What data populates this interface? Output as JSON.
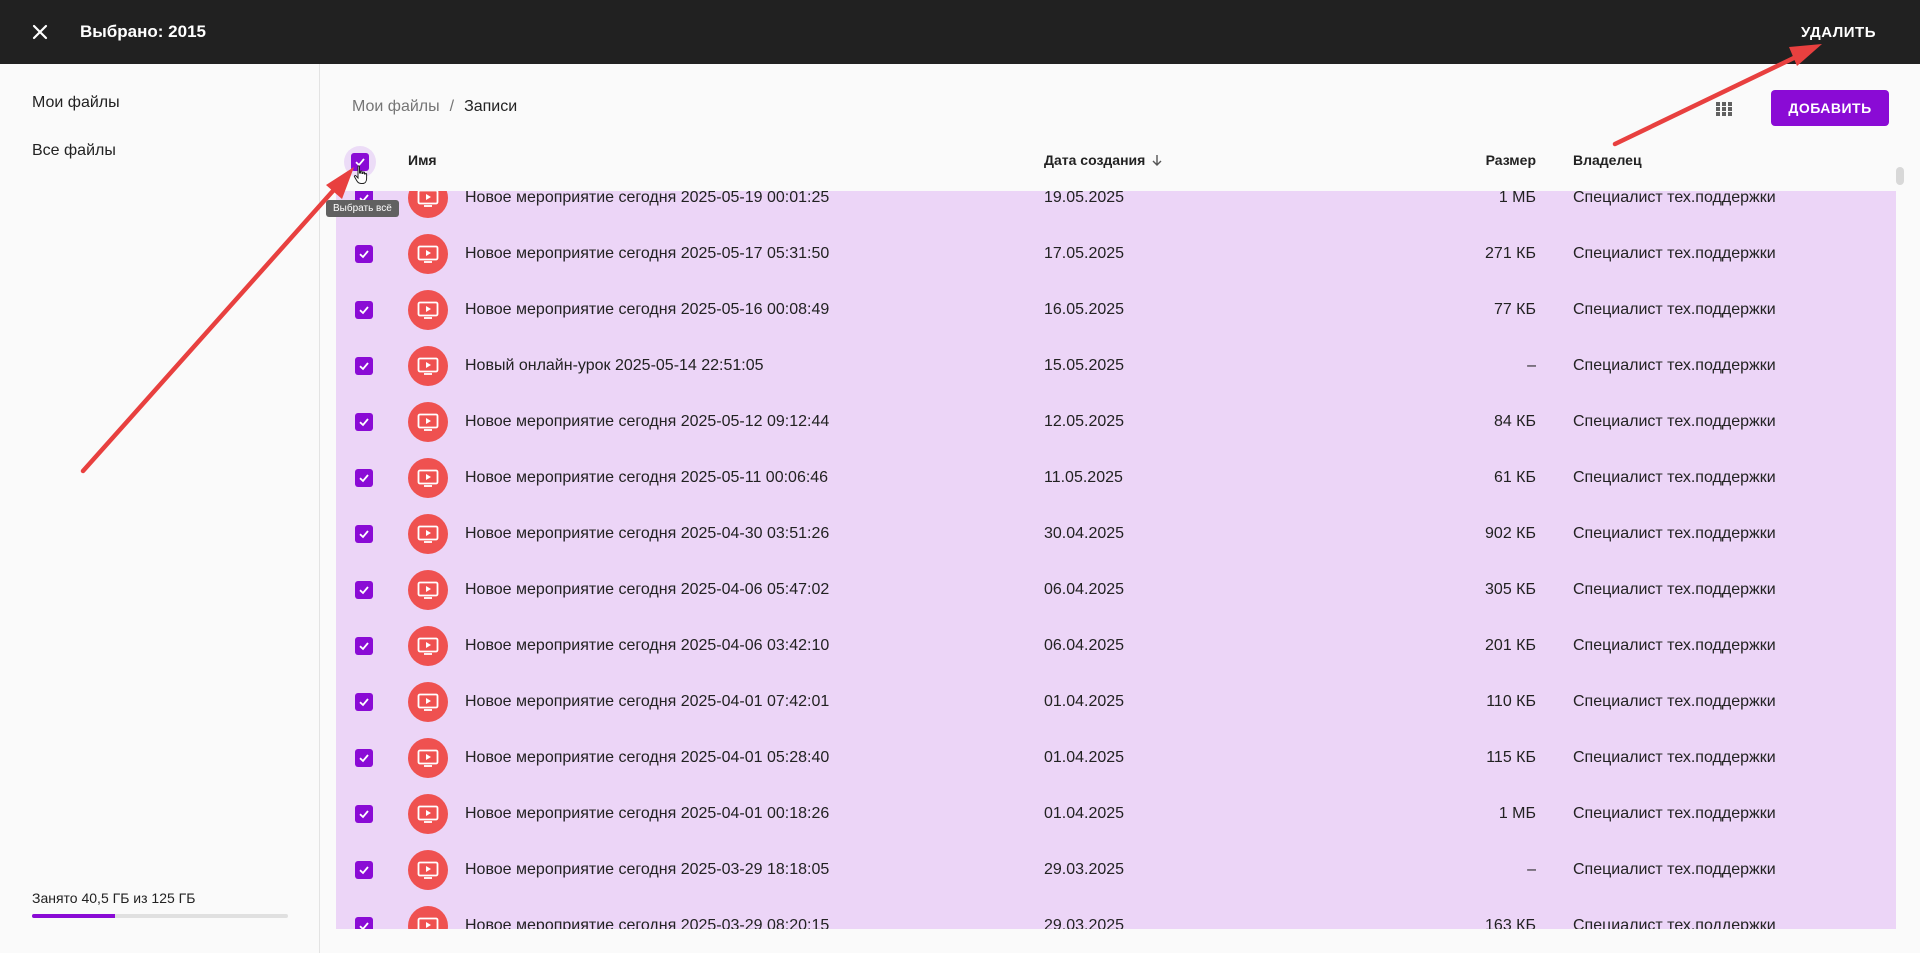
{
  "topbar": {
    "close_icon": "close-icon",
    "selected_label": "Выбрано: 2015",
    "delete_label": "УДАЛИТЬ"
  },
  "sidebar": {
    "items": [
      {
        "label": "Мои файлы"
      },
      {
        "label": "Все файлы"
      }
    ],
    "storage": {
      "label": "Занято 40,5 ГБ из 125 ГБ",
      "used_fraction": 0.324
    }
  },
  "breadcrumb": {
    "parent": "Мои файлы",
    "separator": "/",
    "current": "Записи"
  },
  "toolbar": {
    "grid_icon": "grid-view-icon",
    "add_label": "ДОБАВИТЬ"
  },
  "table": {
    "columns": {
      "name": "Имя",
      "date": "Дата создания",
      "size": "Размер",
      "owner": "Владелец"
    },
    "sort_icon": "arrow-down-icon",
    "select_all_tooltip": "Выбрать всё",
    "rows": [
      {
        "name": "Новое мероприятие сегодня 2025-05-19 00:01:25",
        "date": "19.05.2025",
        "size": "1 МБ",
        "owner": "Специалист тех.поддержки"
      },
      {
        "name": "Новое мероприятие сегодня 2025-05-17 05:31:50",
        "date": "17.05.2025",
        "size": "271 КБ",
        "owner": "Специалист тех.поддержки"
      },
      {
        "name": "Новое мероприятие сегодня 2025-05-16 00:08:49",
        "date": "16.05.2025",
        "size": "77 КБ",
        "owner": "Специалист тех.поддержки"
      },
      {
        "name": "Новый онлайн-урок 2025-05-14 22:51:05",
        "date": "15.05.2025",
        "size": "–",
        "owner": "Специалист тех.поддержки"
      },
      {
        "name": "Новое мероприятие сегодня 2025-05-12 09:12:44",
        "date": "12.05.2025",
        "size": "84 КБ",
        "owner": "Специалист тех.поддержки"
      },
      {
        "name": "Новое мероприятие сегодня 2025-05-11 00:06:46",
        "date": "11.05.2025",
        "size": "61 КБ",
        "owner": "Специалист тех.поддержки"
      },
      {
        "name": "Новое мероприятие сегодня 2025-04-30 03:51:26",
        "date": "30.04.2025",
        "size": "902 КБ",
        "owner": "Специалист тех.поддержки"
      },
      {
        "name": "Новое мероприятие сегодня 2025-04-06 05:47:02",
        "date": "06.04.2025",
        "size": "305 КБ",
        "owner": "Специалист тех.поддержки"
      },
      {
        "name": "Новое мероприятие сегодня 2025-04-06 03:42:10",
        "date": "06.04.2025",
        "size": "201 КБ",
        "owner": "Специалист тех.поддержки"
      },
      {
        "name": "Новое мероприятие сегодня 2025-04-01 07:42:01",
        "date": "01.04.2025",
        "size": "110 КБ",
        "owner": "Специалист тех.поддержки"
      },
      {
        "name": "Новое мероприятие сегодня 2025-04-01 05:28:40",
        "date": "01.04.2025",
        "size": "115 КБ",
        "owner": "Специалист тех.поддержки"
      },
      {
        "name": "Новое мероприятие сегодня 2025-04-01 00:18:26",
        "date": "01.04.2025",
        "size": "1 МБ",
        "owner": "Специалист тех.поддержки"
      },
      {
        "name": "Новое мероприятие сегодня 2025-03-29 18:18:05",
        "date": "29.03.2025",
        "size": "–",
        "owner": "Специалист тех.поддержки"
      },
      {
        "name": "Новое мероприятие сегодня 2025-03-29 08:20:15",
        "date": "29.03.2025",
        "size": "163 КБ",
        "owner": "Специалист тех.поддержки"
      }
    ]
  },
  "colors": {
    "accent": "#8a0bd5",
    "selection_bg": "#ecd5f7",
    "file_icon_bg": "#ef5150",
    "topbar_bg": "#212121",
    "annotation_arrow": "#e8403f"
  }
}
